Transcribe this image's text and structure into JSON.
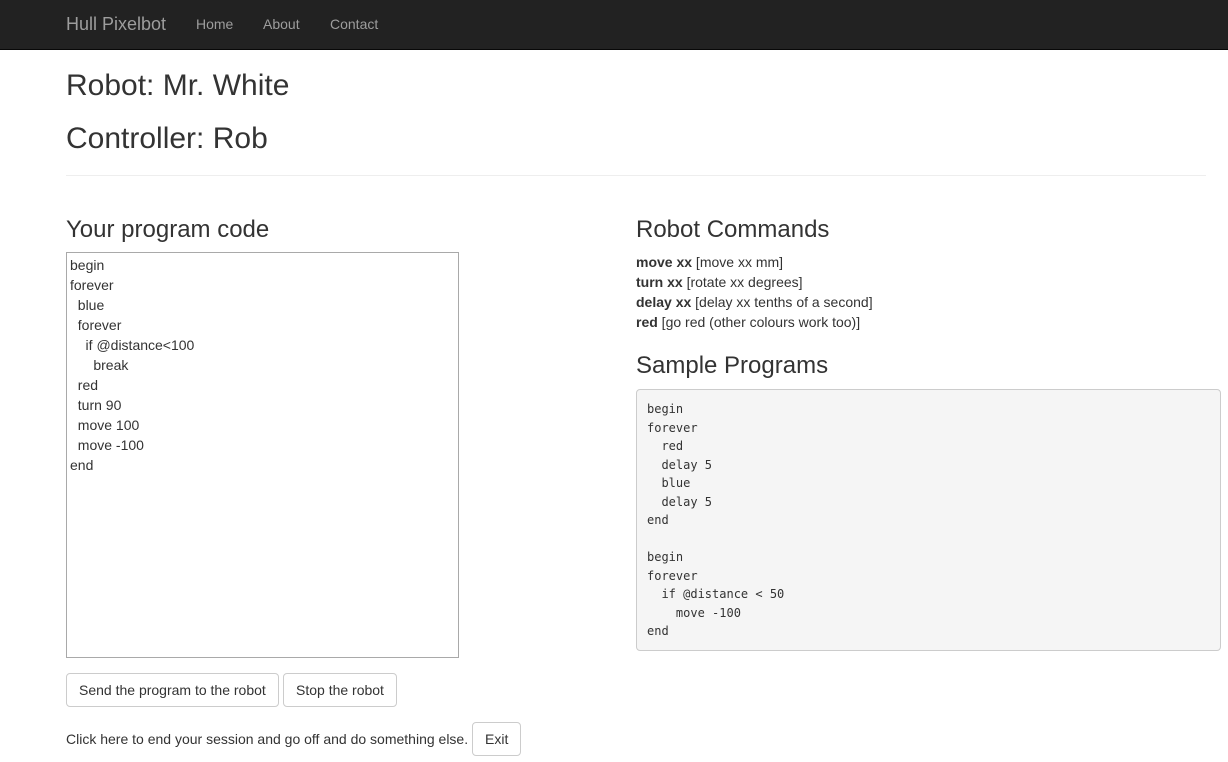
{
  "navbar": {
    "brand": "Hull Pixelbot",
    "links": [
      "Home",
      "About",
      "Contact"
    ]
  },
  "header": {
    "robot": "Robot: Mr. White",
    "controller": "Controller: Rob"
  },
  "editor": {
    "title": "Your program code",
    "code": "begin\nforever\n  blue\n  forever\n    if @distance<100\n      break\n  red\n  turn 90\n  move 100\n  move -100\nend"
  },
  "buttons": {
    "send": "Send the program to the robot",
    "stop": "Stop the robot",
    "exit": "Exit"
  },
  "exit_text": "Click here to end your session and go off and do something else.",
  "commands": {
    "title": "Robot Commands",
    "items": [
      {
        "cmd": "move xx",
        "desc": " [move xx mm]"
      },
      {
        "cmd": "turn xx",
        "desc": " [rotate xx degrees]"
      },
      {
        "cmd": "delay xx",
        "desc": " [delay xx tenths of a second]"
      },
      {
        "cmd": "red",
        "desc": " [go red (other colours work too)]"
      }
    ]
  },
  "samples": {
    "title": "Sample Programs",
    "code": "begin\nforever\n  red\n  delay 5\n  blue\n  delay 5\nend\n\nbegin\nforever\n  if @distance < 50\n    move -100\nend"
  }
}
